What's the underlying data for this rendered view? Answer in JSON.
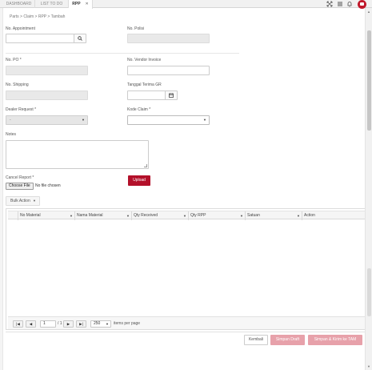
{
  "tabs": [
    "DASHBOARD",
    "LIST TO DO",
    "RPP"
  ],
  "active_tab_close": "✕",
  "toolbar_icons": [
    "expand-icon",
    "menu-icon",
    "bell-icon",
    "avatar"
  ],
  "breadcrumb": "Parts > Claim > RPP > Tambah",
  "form": {
    "no_appointment_label": "No. Appointment",
    "no_polisi_label": "No. Polisi",
    "no_po_label": "No. PO *",
    "no_vendor_invoice_label": "No. Vendor Invoice",
    "no_shipping_label": "No. Shipping",
    "tanggal_terima_gr_label": "Tanggal Terima GR",
    "dealer_request_label": "Dealer Request *",
    "dealer_request_value": "-",
    "kode_claim_label": "Kode Claim *",
    "kode_claim_value": "",
    "notes_label": "Notes",
    "cancel_report_label": "Cancel Report *",
    "choose_file_label": "Choose File",
    "no_file_text": "No file chosen",
    "upload_label": "Upload"
  },
  "bulk_action_label": "Bulk Action",
  "grid": {
    "columns": [
      "No Material",
      "Nama Material",
      "Qty Received",
      "Qty RPP",
      "Satuan",
      "Action"
    ],
    "rows": []
  },
  "pager": {
    "page": "1",
    "of_text": "/ 1",
    "page_size": "250",
    "items_per_page_text": "items per page"
  },
  "actions": {
    "kembali": "Kembali",
    "simpan_draft": "Simpan Draft",
    "simpan_kirim": "Simpan & Kirim ke TAM"
  },
  "colors": {
    "brand": "#b3102a",
    "brand_disabled": "#e7a1aa",
    "readonly_bg": "#e9e9e9"
  }
}
